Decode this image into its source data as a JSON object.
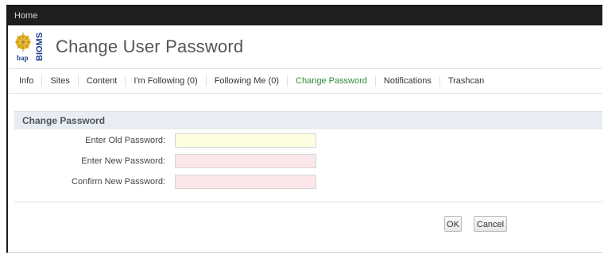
{
  "topbar": {
    "home_label": "Home"
  },
  "header": {
    "title": "Change User Password",
    "logo_text_left": "bap",
    "logo_text_right": "BIOMS"
  },
  "tabs": [
    {
      "label": "Info",
      "active": false
    },
    {
      "label": "Sites",
      "active": false
    },
    {
      "label": "Content",
      "active": false
    },
    {
      "label": "I'm Following (0)",
      "active": false
    },
    {
      "label": "Following Me (0)",
      "active": false
    },
    {
      "label": "Change Password",
      "active": true
    },
    {
      "label": "Notifications",
      "active": false
    },
    {
      "label": "Trashcan",
      "active": false
    }
  ],
  "form": {
    "section_title": "Change Password",
    "old_password_label": "Enter Old Password:",
    "new_password_label": "Enter New Password:",
    "confirm_password_label": "Confirm New Password:",
    "old_password_value": "",
    "new_password_value": "",
    "confirm_password_value": ""
  },
  "buttons": {
    "ok_label": "OK",
    "cancel_label": "Cancel"
  },
  "colors": {
    "topbar": "#1e1e1e",
    "active_tab": "#2e8b3a",
    "section_header": "#e9edf1",
    "old_field_bg": "#fdfde0",
    "new_field_bg": "#fbe7ea"
  }
}
